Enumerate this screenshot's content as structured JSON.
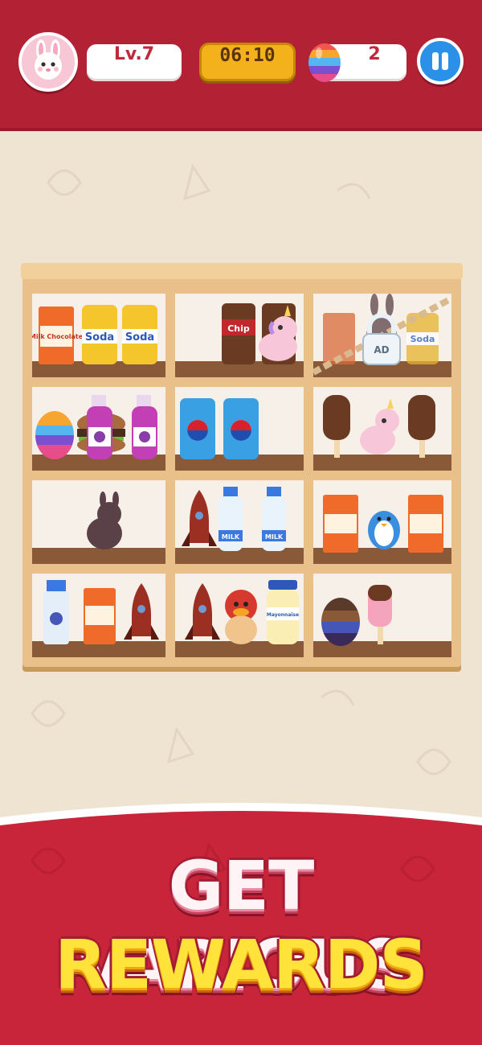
{
  "hud": {
    "level": "Lv.7",
    "timer": "06:10",
    "egg_count": "2"
  },
  "shelf": {
    "cells": [
      {
        "items": [
          "Milk Chocolate box",
          "Soda can",
          "Soda can"
        ],
        "locked": false
      },
      {
        "items": [
          "Chip can",
          "Chip can",
          "Unicorn toy"
        ],
        "locked": false
      },
      {
        "items": [
          "Milk Chocolate box",
          "Bunny toy",
          "Soda can"
        ],
        "locked": true,
        "lock_label": "AD"
      },
      {
        "items": [
          "Rainbow egg",
          "Hamburger",
          "Grape juice bottle",
          "Grape juice bottle"
        ],
        "locked": false
      },
      {
        "items": [
          "Cola can",
          "Cola can"
        ],
        "locked": false
      },
      {
        "items": [
          "Chocolate ice cream",
          "Unicorn toy",
          "Chocolate ice cream"
        ],
        "locked": false
      },
      {
        "items": [
          "Bunny toy"
        ],
        "locked": false
      },
      {
        "items": [
          "Rocket",
          "Milk bottle",
          "Milk bottle"
        ],
        "locked": false
      },
      {
        "items": [
          "Milk Chocolate box",
          "Penguin toy",
          "Milk Chocolate box"
        ],
        "locked": false
      },
      {
        "items": [
          "Blueberry milk",
          "Milk Chocolate box",
          "Rocket"
        ],
        "locked": false
      },
      {
        "items": [
          "Rocket",
          "Dino toy",
          "Mayonnaise jar"
        ],
        "locked": false
      },
      {
        "items": [
          "Chocolate egg",
          "Ice cream"
        ],
        "locked": false
      }
    ],
    "labels": {
      "soda": "Soda",
      "chip": "Chip",
      "milk": "MILK",
      "milk_choc": "Milk Chocolate",
      "mayo": "Mayonnaise"
    }
  },
  "banner": {
    "line1": "GET VARIOUS",
    "line2": "REWARDS"
  },
  "colors": {
    "hud_red": "#b32134",
    "timer_gold": "#f3b21c",
    "pause_blue": "#2b90e8",
    "wood": "#e9c08a",
    "banner_red": "#c8243a"
  }
}
